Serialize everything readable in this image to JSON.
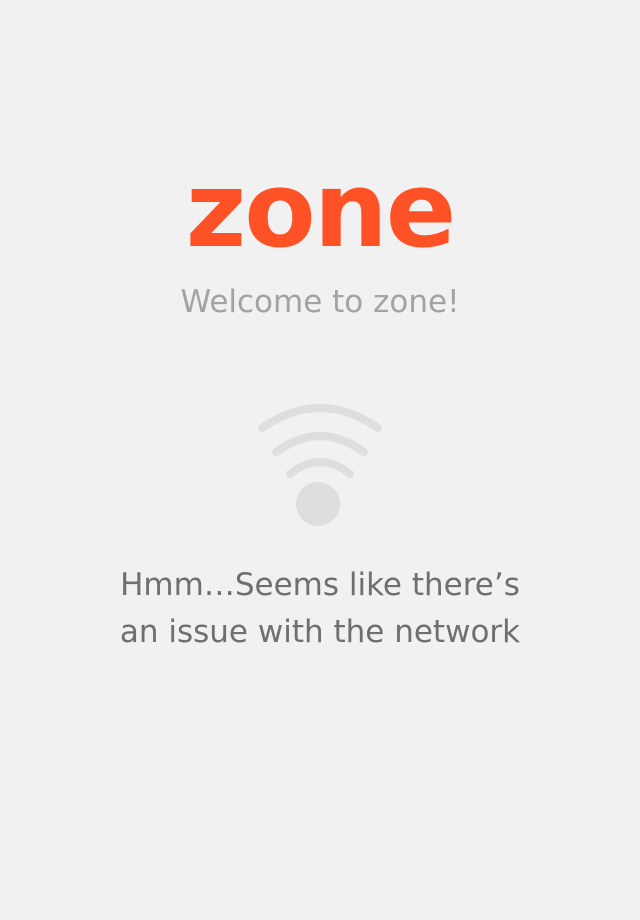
{
  "app": {
    "logo_text": "zone",
    "welcome_text": "Welcome to zone!"
  },
  "error": {
    "icon": "wifi-icon",
    "message_line1": "Hmm…Seems like there’s",
    "message_line2": "an issue with the network"
  },
  "colors": {
    "brand": "#ff5126",
    "background": "#f1f1f1",
    "icon": "#dedede",
    "message_text": "#6f6f6f",
    "welcome_text": "#a3a3a3"
  }
}
